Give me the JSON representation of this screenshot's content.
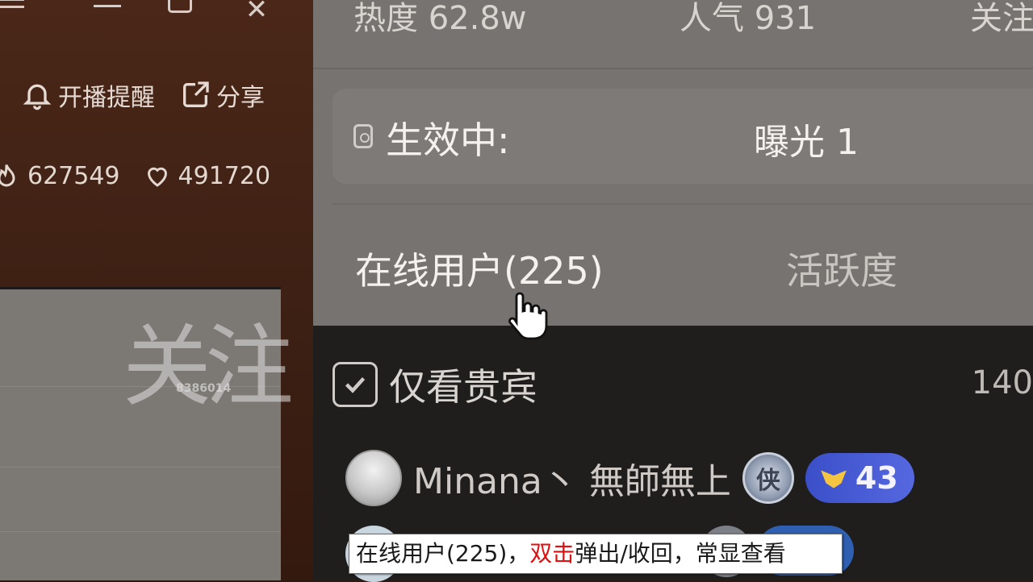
{
  "left_panel": {
    "actions": {
      "remind_label": "开播提醒",
      "share_label": "分享"
    },
    "stats": {
      "fire_count": "627549",
      "like_count": "491720"
    },
    "preview": {
      "watermark_id": "8386014"
    }
  },
  "right_panel": {
    "stats": {
      "heat": "热度 62.8w",
      "popularity": "人气 931",
      "follow_partial": "关注"
    },
    "status": {
      "label": "生效中:",
      "value": "曝光 1"
    },
    "tabs": [
      {
        "label": "在线用户(225)"
      },
      {
        "label": "活跃度"
      }
    ],
    "filter": {
      "label": "仅看贵宾",
      "count": "140",
      "checked": true
    },
    "users": [
      {
        "name": "Minana丶 無師無上",
        "round_badge": "侠",
        "level": "43"
      }
    ]
  },
  "tooltip": {
    "prefix": "在线用户(225)，",
    "highlight": "双击",
    "suffix": "弹出/收回，常显查看"
  },
  "colors": {
    "level_badge": "#4a5bd6",
    "tooltip_highlight": "#e01010"
  }
}
